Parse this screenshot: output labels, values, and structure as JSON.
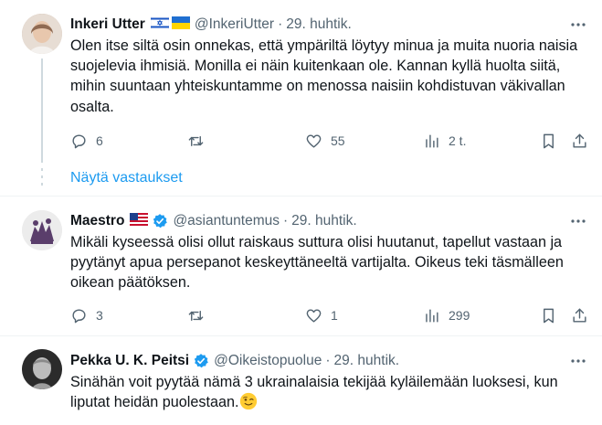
{
  "tweets": [
    {
      "name": "Inkeri Utter",
      "flags": [
        "israel-flag",
        "ukraine-flag"
      ],
      "handle": "@InkeriUtter",
      "sep": "·",
      "time": "29. huhtik.",
      "text": "Olen itse siltä osin onnekas, että ympäriltä löytyy minua ja muita nuoria naisia suojelevia ihmisiä. Monilla ei näin kuitenkaan ole. Kannan kyllä huolta siitä, mihin suuntaan yhteiskuntamme on menossa naisiin kohdistuvan väkivallan osalta.",
      "replies": "6",
      "retweets": "",
      "likes": "55",
      "views": "2 t."
    },
    {
      "name": "Maestro",
      "flags": [
        "usa-flag"
      ],
      "verified": true,
      "handle": "@asiantuntemus",
      "sep": "·",
      "time": "29. huhtik.",
      "text": "Mikäli kyseessä olisi ollut raiskaus suttura olisi huutanut, tapellut vastaan ja pyytänyt apua persepanot keskeyttäneeltä vartijalta. Oikeus teki täsmälleen oikean päätöksen.",
      "replies": "3",
      "retweets": "",
      "likes": "1",
      "views": "299"
    },
    {
      "name": "Pekka U. K. Peitsi",
      "verified": true,
      "handle": "@Oikeistopuolue",
      "sep": "·",
      "time": "29. huhtik.",
      "text": "Sinähän voit pyytää nämä 3 ukrainalaisia tekijää kyläilemään luoksesi, kun liputat heidän puolestaan.",
      "emoji": "winking-face-emoji"
    }
  ],
  "show_replies": "Näytä vastaukset",
  "colors": {
    "accent": "#1d9bf0",
    "muted": "#536471",
    "text": "#0f1419",
    "divider": "#eff3f4"
  }
}
